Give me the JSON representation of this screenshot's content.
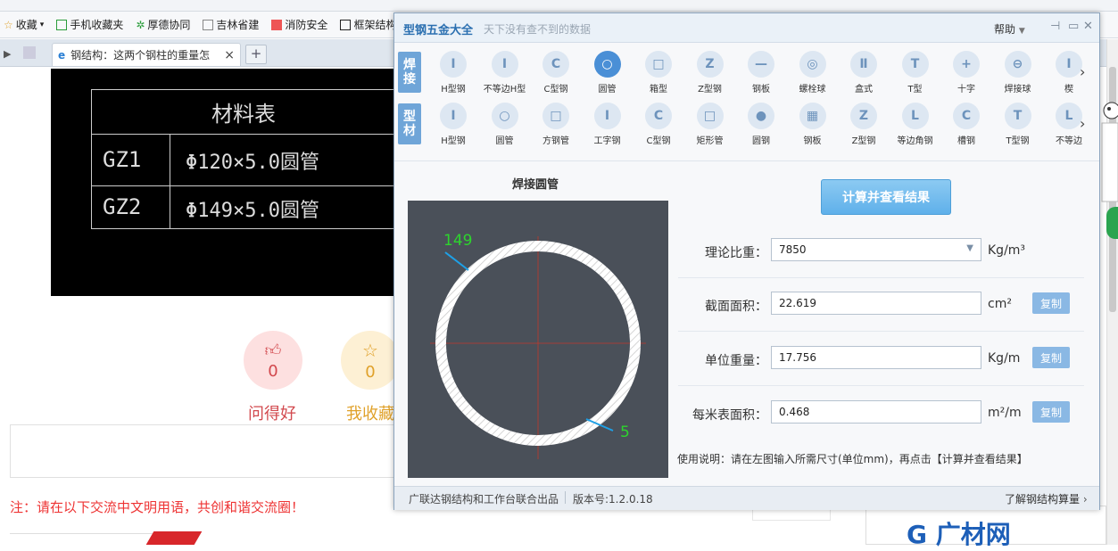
{
  "browser": {
    "bookmarks": [
      "收藏",
      "手机收藏夹",
      "厚德协同",
      "吉林省建",
      "消防安全",
      "框架结构"
    ],
    "tab_title": "钢结构：这两个钢柱的重量怎",
    "tab_close": "×",
    "new_tab": "+"
  },
  "page": {
    "material_table": {
      "title": "材料表",
      "rows": [
        {
          "code": "GZ1",
          "spec": "Φ120×5.0圆管"
        },
        {
          "code": "GZ2",
          "spec": "Φ149×5.0圆管"
        }
      ]
    },
    "like": {
      "count": "0",
      "label": "问得好"
    },
    "favorite": {
      "count": "0",
      "label": "我收藏"
    },
    "notice": "注：请在以下交流中文明用语，共创和谐交流圈！",
    "logo_text": "广材网"
  },
  "app": {
    "title": "型钢五金大全",
    "subtitle": "天下没有查不到的数据",
    "help": "帮助",
    "weld_tag": [
      "焊",
      "接"
    ],
    "weld_items": [
      {
        "label": "H型钢",
        "glyph": "I"
      },
      {
        "label": "不等边H型",
        "glyph": "I"
      },
      {
        "label": "C型钢",
        "glyph": "C"
      },
      {
        "label": "圆管",
        "glyph": "○"
      },
      {
        "label": "箱型",
        "glyph": "□"
      },
      {
        "label": "Z型钢",
        "glyph": "Z"
      },
      {
        "label": "钢板",
        "glyph": "—"
      },
      {
        "label": "螺栓球",
        "glyph": "◎"
      },
      {
        "label": "盒式",
        "glyph": "Ⅱ"
      },
      {
        "label": "T型",
        "glyph": "T"
      },
      {
        "label": "十字",
        "glyph": "+"
      },
      {
        "label": "焊接球",
        "glyph": "⊖"
      },
      {
        "label": "楔",
        "glyph": "I"
      }
    ],
    "profile_tag": [
      "型",
      "材"
    ],
    "profile_items": [
      {
        "label": "H型钢",
        "glyph": "I"
      },
      {
        "label": "圆管",
        "glyph": "○"
      },
      {
        "label": "方钢管",
        "glyph": "□"
      },
      {
        "label": "工字钢",
        "glyph": "I"
      },
      {
        "label": "C型钢",
        "glyph": "C"
      },
      {
        "label": "矩形管",
        "glyph": "□"
      },
      {
        "label": "圆钢",
        "glyph": "●"
      },
      {
        "label": "钢板",
        "glyph": "▦"
      },
      {
        "label": "Z型钢",
        "glyph": "Z"
      },
      {
        "label": "等边角钢",
        "glyph": "L"
      },
      {
        "label": "槽钢",
        "glyph": "C"
      },
      {
        "label": "T型钢",
        "glyph": "T"
      },
      {
        "label": "不等边",
        "glyph": "L"
      }
    ],
    "panel_title": "焊接圆管",
    "diagram": {
      "diameter": "149",
      "thickness": "5"
    },
    "calc_button": "计算并查看结果",
    "fields": [
      {
        "label": "理论比重：",
        "value": "7850",
        "unit": "Kg/m³",
        "copy": ""
      },
      {
        "label": "截面面积：",
        "value": "22.619",
        "unit": "cm²",
        "copy": "复制"
      },
      {
        "label": "单位重量：",
        "value": "17.756",
        "unit": "Kg/m",
        "copy": "复制"
      },
      {
        "label": "每米表面积：",
        "value": "0.468",
        "unit": "m²/m",
        "copy": "复制"
      }
    ],
    "usage": "使用说明：请在左图输入所需尺寸(单位mm)，再点击【计算并查看结果】",
    "status_left": "广联达钢结构和工作台联合出品",
    "version": "版本号:1.2.0.18",
    "status_right": "了解钢结构算量"
  }
}
